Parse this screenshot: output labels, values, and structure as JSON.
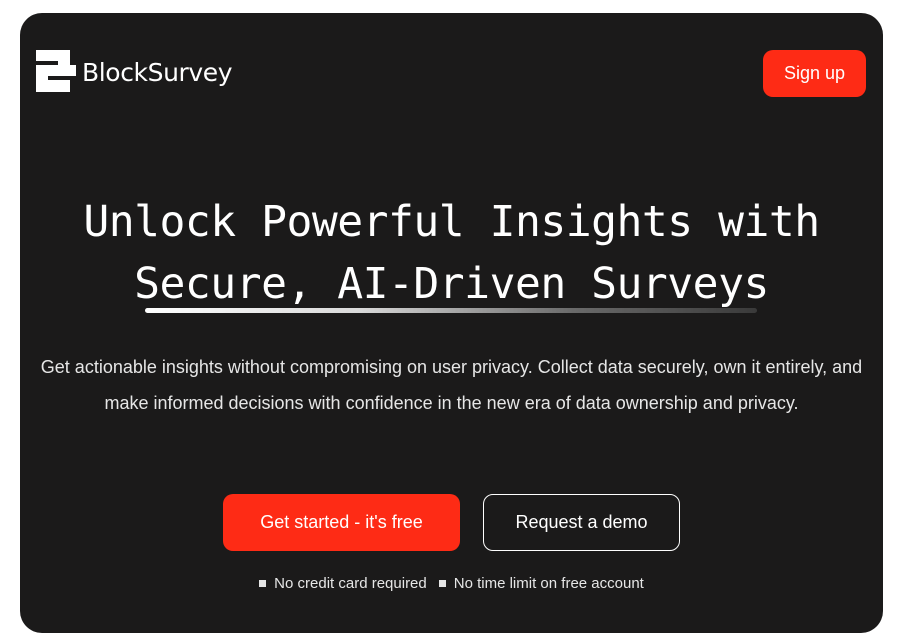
{
  "brand": {
    "name": "BlockSurvey"
  },
  "nav": {
    "signup_label": "Sign up"
  },
  "hero": {
    "headline_line1": "Unlock Powerful Insights with",
    "headline_line2": "Secure, AI-Driven Surveys",
    "subtext": "Get actionable insights without compromising on user privacy. Collect data securely, own it entirely, and make informed decisions with confidence in the new era of data ownership and privacy.",
    "cta_primary": "Get started - it's free",
    "cta_secondary": "Request a demo",
    "notes": [
      "No credit card required",
      "No time limit on free account"
    ]
  },
  "colors": {
    "background": "#1b1a1a",
    "accent": "#fe2b15",
    "text": "#ffffff"
  }
}
